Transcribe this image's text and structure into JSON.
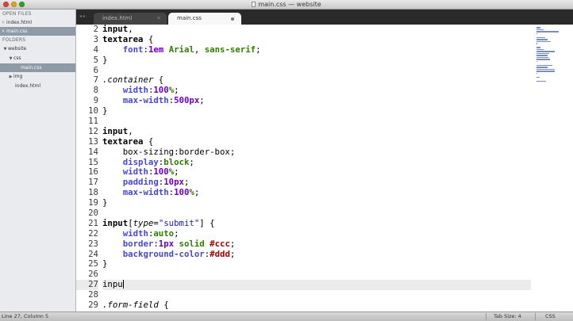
{
  "window": {
    "title": "main.css — website"
  },
  "sidebar": {
    "open_files_header": "OPEN FILES",
    "open_files": [
      {
        "label": "index.html",
        "selected": false
      },
      {
        "label": "main.css",
        "selected": true
      }
    ],
    "folders_header": "FOLDERS",
    "tree": [
      {
        "label": "website",
        "caret": "▼"
      },
      {
        "label": "css",
        "caret": "▼"
      },
      {
        "label": "main.css",
        "caret": ""
      },
      {
        "label": "img",
        "caret": "▶"
      },
      {
        "label": "index.html",
        "caret": ""
      }
    ]
  },
  "tabs": [
    {
      "label": "index.html",
      "active": false
    },
    {
      "label": "main.css",
      "active": true
    }
  ],
  "tab_nav": "◂ ▸",
  "editor": {
    "current_line": 27,
    "lines": [
      {
        "n": "2",
        "t": [
          [
            "sel",
            "input"
          ],
          [
            "plain",
            ","
          ]
        ]
      },
      {
        "n": "3",
        "t": [
          [
            "sel",
            "textarea"
          ],
          [
            "plain",
            " {"
          ]
        ]
      },
      {
        "n": "4",
        "t": [
          [
            "plain",
            "    "
          ],
          [
            "prop",
            "font"
          ],
          [
            "plain",
            ":"
          ],
          [
            "num",
            "1em"
          ],
          [
            "plain",
            " "
          ],
          [
            "val",
            "Arial"
          ],
          [
            "plain",
            ", "
          ],
          [
            "val",
            "sans-serif"
          ],
          [
            "plain",
            ";"
          ]
        ]
      },
      {
        "n": "5",
        "t": [
          [
            "plain",
            "}"
          ]
        ]
      },
      {
        "n": "6",
        "t": []
      },
      {
        "n": "7",
        "t": [
          [
            "cls",
            ".container"
          ],
          [
            "plain",
            " {"
          ]
        ]
      },
      {
        "n": "8",
        "t": [
          [
            "plain",
            "    "
          ],
          [
            "prop",
            "width"
          ],
          [
            "plain",
            ":"
          ],
          [
            "num",
            "100"
          ],
          [
            "pct",
            "%"
          ],
          [
            "plain",
            ";"
          ]
        ]
      },
      {
        "n": "9",
        "t": [
          [
            "plain",
            "    "
          ],
          [
            "prop",
            "max-width"
          ],
          [
            "plain",
            ":"
          ],
          [
            "num",
            "500px"
          ],
          [
            "plain",
            ";"
          ]
        ]
      },
      {
        "n": "10",
        "t": [
          [
            "plain",
            "}"
          ]
        ]
      },
      {
        "n": "11",
        "t": []
      },
      {
        "n": "12",
        "t": [
          [
            "sel",
            "input"
          ],
          [
            "plain",
            ","
          ]
        ]
      },
      {
        "n": "13",
        "t": [
          [
            "sel",
            "textarea"
          ],
          [
            "plain",
            " {"
          ]
        ]
      },
      {
        "n": "14",
        "t": [
          [
            "plain",
            "    box-sizing:border-box;"
          ]
        ]
      },
      {
        "n": "15",
        "t": [
          [
            "plain",
            "    "
          ],
          [
            "prop",
            "display"
          ],
          [
            "plain",
            ":"
          ],
          [
            "val",
            "block"
          ],
          [
            "plain",
            ";"
          ]
        ]
      },
      {
        "n": "16",
        "t": [
          [
            "plain",
            "    "
          ],
          [
            "prop",
            "width"
          ],
          [
            "plain",
            ":"
          ],
          [
            "num",
            "100"
          ],
          [
            "pct",
            "%"
          ],
          [
            "plain",
            ";"
          ]
        ]
      },
      {
        "n": "17",
        "t": [
          [
            "plain",
            "    "
          ],
          [
            "prop",
            "padding"
          ],
          [
            "plain",
            ":"
          ],
          [
            "num",
            "10px"
          ],
          [
            "plain",
            ";"
          ]
        ]
      },
      {
        "n": "18",
        "t": [
          [
            "plain",
            "    "
          ],
          [
            "prop",
            "max-width"
          ],
          [
            "plain",
            ":"
          ],
          [
            "num",
            "100"
          ],
          [
            "pct",
            "%"
          ],
          [
            "plain",
            ";"
          ]
        ]
      },
      {
        "n": "19",
        "t": [
          [
            "plain",
            "}"
          ]
        ]
      },
      {
        "n": "20",
        "t": []
      },
      {
        "n": "21",
        "t": [
          [
            "sel",
            "input"
          ],
          [
            "plain",
            "["
          ],
          [
            "attr",
            "type"
          ],
          [
            "plain",
            "="
          ],
          [
            "str",
            "\"submit\""
          ],
          [
            "plain",
            "] {"
          ]
        ]
      },
      {
        "n": "22",
        "t": [
          [
            "plain",
            "    "
          ],
          [
            "prop",
            "width"
          ],
          [
            "plain",
            ":"
          ],
          [
            "val",
            "auto"
          ],
          [
            "plain",
            ";"
          ]
        ]
      },
      {
        "n": "23",
        "t": [
          [
            "plain",
            "    "
          ],
          [
            "prop",
            "border"
          ],
          [
            "plain",
            ":"
          ],
          [
            "num",
            "1px"
          ],
          [
            "plain",
            " "
          ],
          [
            "val",
            "solid"
          ],
          [
            "plain",
            " "
          ],
          [
            "hex",
            "#ccc"
          ],
          [
            "plain",
            ";"
          ]
        ]
      },
      {
        "n": "24",
        "t": [
          [
            "plain",
            "    "
          ],
          [
            "prop",
            "background-color"
          ],
          [
            "plain",
            ":"
          ],
          [
            "hex",
            "#ddd"
          ],
          [
            "plain",
            ";"
          ]
        ]
      },
      {
        "n": "25",
        "t": [
          [
            "plain",
            "}"
          ]
        ]
      },
      {
        "n": "26",
        "t": []
      },
      {
        "n": "27",
        "t": [
          [
            "plain",
            "inpu"
          ]
        ]
      },
      {
        "n": "28",
        "t": []
      },
      {
        "n": "29",
        "t": [
          [
            "cls",
            ".form-field"
          ],
          [
            "plain",
            " {"
          ]
        ]
      }
    ]
  },
  "statusbar": {
    "position": "Line 27, Column 5",
    "tab_size": "Tab Size: 4",
    "syntax": "CSS"
  }
}
